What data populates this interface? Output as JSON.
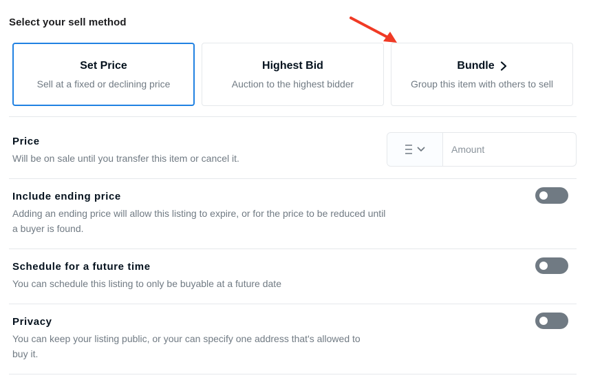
{
  "header": {
    "title": "Select your sell method"
  },
  "sell_methods": [
    {
      "title": "Set Price",
      "subtitle": "Sell at a fixed or declining price",
      "selected": true
    },
    {
      "title": "Highest Bid",
      "subtitle": "Auction to the highest bidder",
      "selected": false
    },
    {
      "title": "Bundle",
      "subtitle": "Group this item with others to sell",
      "selected": false
    }
  ],
  "price": {
    "title": "Price",
    "description": "Will be on sale until you transfer this item or cancel it.",
    "currency_icon": "ethereum-icon",
    "amount_placeholder": "Amount",
    "amount_value": ""
  },
  "options": [
    {
      "title": "Include ending price",
      "description": "Adding an ending price will allow this listing to expire, or for the price to be reduced until a buyer is found.",
      "enabled": false
    },
    {
      "title": "Schedule for a future time",
      "description": "You can schedule this listing to only be buyable at a future date",
      "enabled": false
    },
    {
      "title": "Privacy",
      "description": "You can keep your listing public, or your can specify one address that's allowed to buy it.",
      "enabled": false
    }
  ],
  "colors": {
    "accent": "#2081e2",
    "toggle_off": "#707a83",
    "annotation_arrow": "#f03a25"
  }
}
